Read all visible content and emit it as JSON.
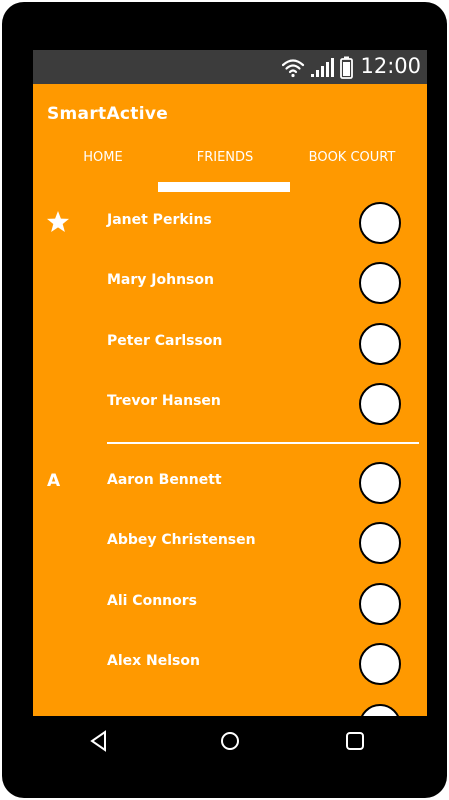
{
  "status_bar": {
    "time": "12:00",
    "icons": [
      "wifi-icon",
      "signal-icon",
      "battery-icon"
    ]
  },
  "app": {
    "title": "SmartActive"
  },
  "tabs": [
    {
      "label": "HOME",
      "selected": false
    },
    {
      "label": "FRIENDS",
      "selected": true
    },
    {
      "label": "BOOK COURT",
      "selected": false
    }
  ],
  "favorites_marker": "star-icon",
  "favorites": [
    {
      "name": "Janet Perkins"
    },
    {
      "name": "Mary Johnson"
    },
    {
      "name": "Peter Carlsson"
    },
    {
      "name": "Trevor Hansen"
    }
  ],
  "section_a": {
    "letter": "A",
    "items": [
      {
        "name": "Aaron Bennett"
      },
      {
        "name": "Abbey Christensen"
      },
      {
        "name": "Ali Connors"
      },
      {
        "name": "Alex Nelson"
      }
    ]
  },
  "nav": [
    "back-icon",
    "home-icon",
    "recents-icon"
  ],
  "colors": {
    "accent": "#ff9900",
    "status_bar": "#3c3c3c",
    "frame": "#000000",
    "text": "#ffffff"
  }
}
